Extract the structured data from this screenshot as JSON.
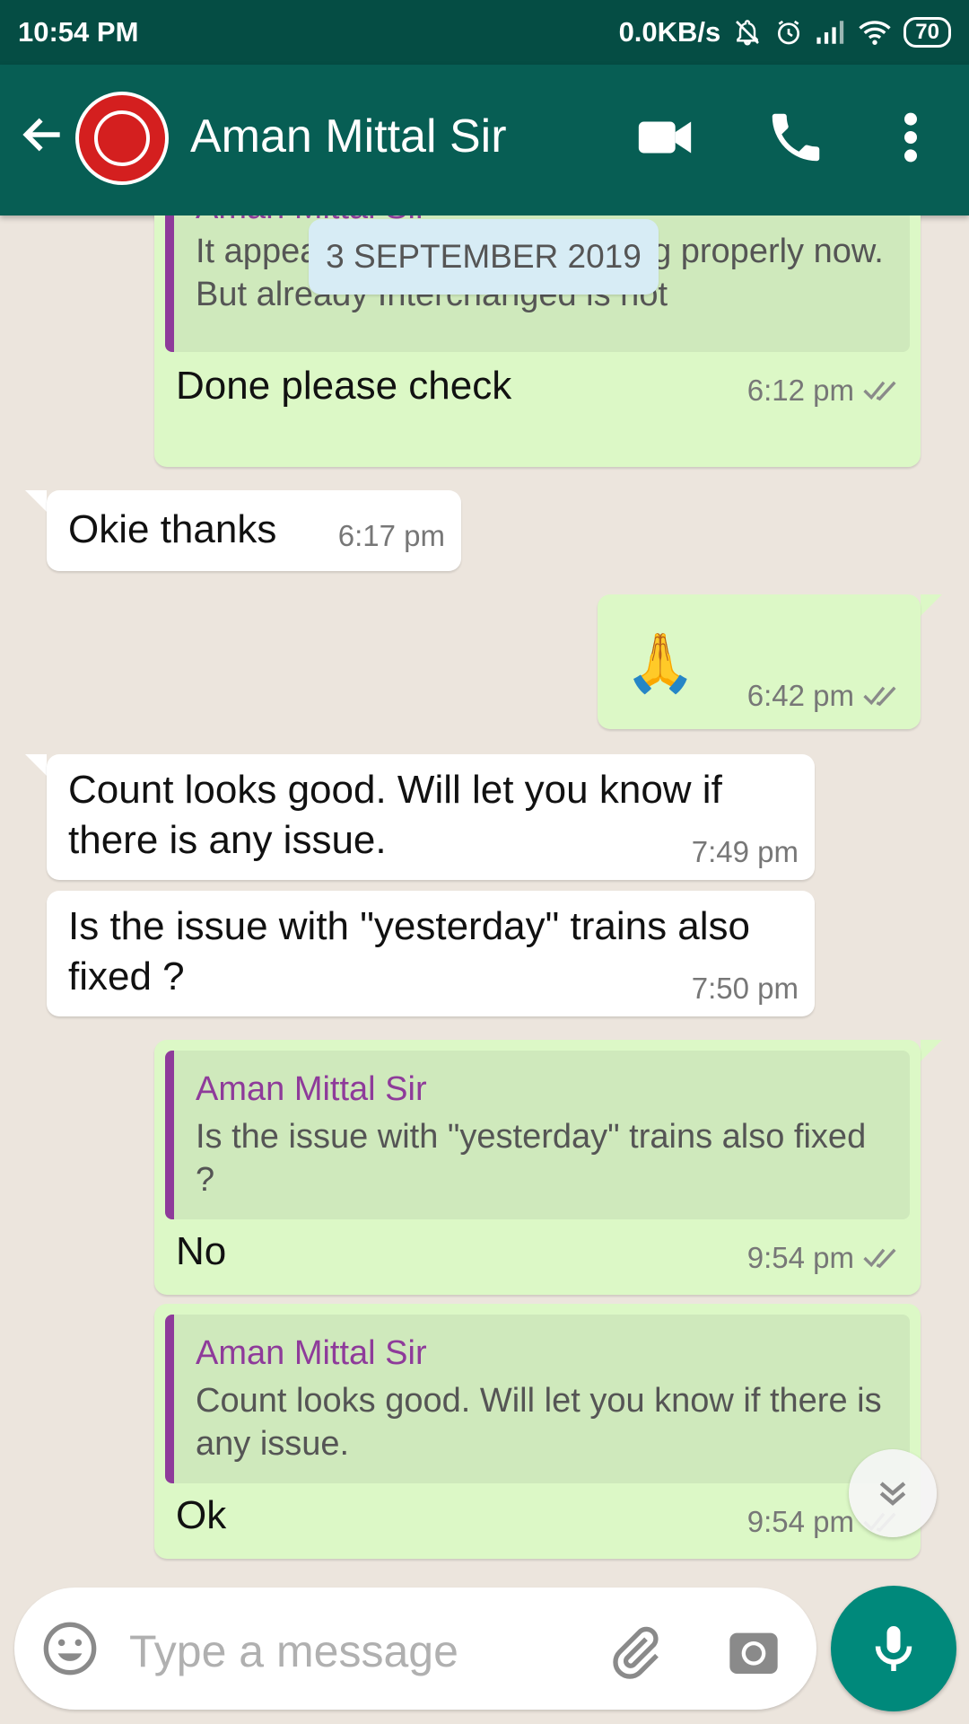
{
  "status_bar": {
    "time": "10:54 PM",
    "net_speed": "0.0KB/s",
    "battery": "70",
    "icons": [
      "mute-notification-icon",
      "alarm-icon",
      "signal-icon",
      "wifi-icon",
      "battery-icon"
    ]
  },
  "header": {
    "contact_name": "Aman Mittal Sir",
    "icons": [
      "back-arrow-icon",
      "avatar",
      "video-call-icon",
      "voice-call-icon",
      "more-options-icon"
    ]
  },
  "date_chip": "3 SEPTEMBER 2019",
  "messages": [
    {
      "direction": "out",
      "quote_author": "Aman Mittal Sir",
      "quote_text": "It appears interchanges coming properly now. But already Interchanged is not",
      "text": "Done please check",
      "time": "6:12 pm",
      "ticks": "read"
    },
    {
      "direction": "in",
      "text": "Okie thanks",
      "time": "6:17 pm"
    },
    {
      "direction": "out",
      "text": "🙏",
      "time": "6:42 pm",
      "ticks": "read"
    },
    {
      "direction": "in",
      "text": "Count looks good. Will let you know if there is any issue.",
      "time": "7:49 pm"
    },
    {
      "direction": "in",
      "text": "Is the issue with \"yesterday\" trains also fixed ?",
      "time": "7:50 pm"
    },
    {
      "direction": "out",
      "quote_author": "Aman Mittal Sir",
      "quote_text": "Is the issue with \"yesterday\" trains also fixed ?",
      "text": "No",
      "time": "9:54 pm",
      "ticks": "read"
    },
    {
      "direction": "out",
      "quote_author": "Aman Mittal Sir",
      "quote_text": "Count looks good. Will let you know if there is any issue.",
      "text": "Ok",
      "time": "9:54 pm",
      "ticks": "read"
    }
  ],
  "composer": {
    "placeholder": "Type a message",
    "icons": [
      "emoji-icon",
      "attach-icon",
      "camera-icon",
      "microphone-icon"
    ]
  },
  "colors": {
    "header": "#075e54",
    "status_bar": "#054d44",
    "outgoing_bubble": "#dcf8c6",
    "incoming_bubble": "#ffffff",
    "quote_author": "#8e3b9a",
    "read_ticks": "#8a8a8a",
    "mic_button": "#00897b"
  }
}
